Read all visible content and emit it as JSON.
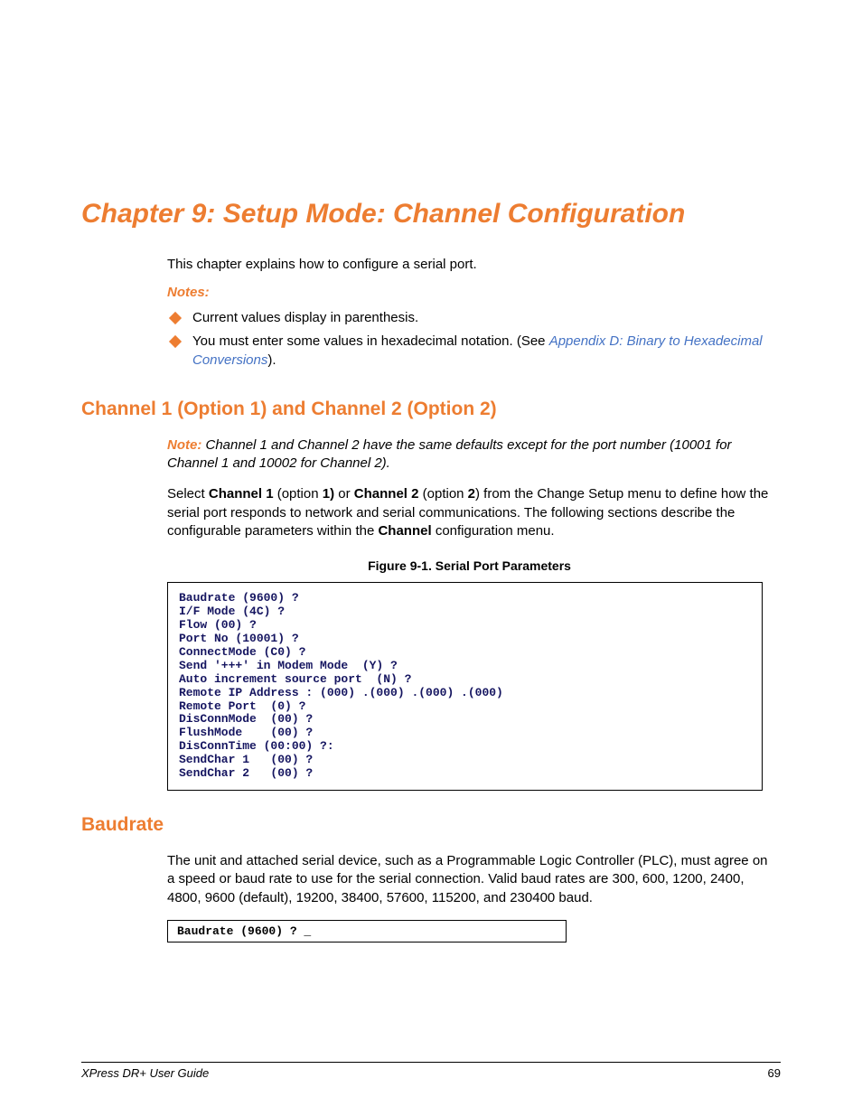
{
  "chapter_title": "Chapter 9: Setup Mode: Channel Configuration",
  "intro": "This chapter explains how to configure a serial port.",
  "notes_label": "Notes:",
  "bullets": {
    "b1": "Current values display in parenthesis.",
    "b2_pre": "You must enter some values in hexadecimal notation. (See ",
    "b2_link": "Appendix D: Binary to Hexadecimal Conversions",
    "b2_post": ")."
  },
  "section1_title": "Channel 1 (Option 1) and Channel 2 (Option 2)",
  "note_label": "Note:",
  "note_body": " Channel 1 and Channel 2 have the same defaults except for the port number (10001 for Channel 1 and 10002 for Channel 2).",
  "para_pre": "Select ",
  "ch1": "Channel 1",
  "para_mid1": " (option ",
  "opt1": "1)",
  "para_mid2": " or ",
  "ch2": "Channel 2",
  "para_mid3": " (option ",
  "opt2": "2",
  "para_mid4": ") from the Change Setup menu to define how the serial port responds to network and serial communications. The following sections describe the configurable parameters within the ",
  "channel_word": "Channel",
  "para_end": " configuration menu.",
  "figure_caption": "Figure 9-1. Serial Port Parameters",
  "code_block": "Baudrate (9600) ?\nI/F Mode (4C) ?\nFlow (00) ?\nPort No (10001) ?\nConnectMode (C0) ?\nSend '+++' in Modem Mode  (Y) ?\nAuto increment source port  (N) ?\nRemote IP Address : (000) .(000) .(000) .(000)\nRemote Port  (0) ?\nDisConnMode  (00) ?\nFlushMode    (00) ?\nDisConnTime (00:00) ?:\nSendChar 1   (00) ?\nSendChar 2   (00) ?",
  "section2_title": "Baudrate",
  "baud_para": "The unit and attached serial device, such as a Programmable Logic Controller (PLC), must agree on a speed or baud rate to use for the serial connection. Valid baud rates are 300, 600, 1200, 2400, 4800, 9600 (default), 19200, 38400, 57600, 115200, and 230400 baud.",
  "code2": "Baudrate (9600) ? _",
  "footer_left": "XPress DR+ User Guide",
  "footer_right": "69"
}
